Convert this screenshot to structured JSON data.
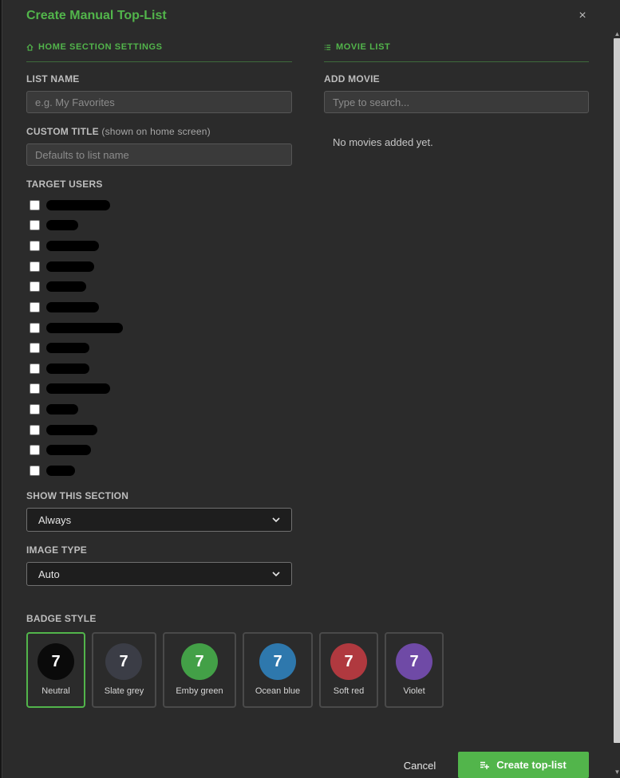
{
  "dialog": {
    "title": "Create Manual Top-List",
    "close_glyph": "×"
  },
  "home_section": {
    "heading": "HOME SECTION SETTINGS",
    "icon": "home-icon",
    "list_name_label": "LIST NAME",
    "list_name_placeholder": "e.g. My Favorites",
    "custom_title_label": "CUSTOM TITLE",
    "custom_title_sub": "(shown on home screen)",
    "custom_title_placeholder": "Defaults to list name",
    "target_users_label": "TARGET USERS",
    "users": [
      {
        "checked": false,
        "redacted": true
      },
      {
        "checked": false,
        "redacted": true
      },
      {
        "checked": false,
        "redacted": true
      },
      {
        "checked": false,
        "redacted": true
      },
      {
        "checked": false,
        "redacted": true
      },
      {
        "checked": false,
        "redacted": true
      },
      {
        "checked": false,
        "redacted": true
      },
      {
        "checked": false,
        "redacted": true
      },
      {
        "checked": false,
        "redacted": true
      },
      {
        "checked": false,
        "redacted": true
      },
      {
        "checked": false,
        "redacted": true
      },
      {
        "checked": false,
        "redacted": true
      },
      {
        "checked": false,
        "redacted": true
      },
      {
        "checked": false,
        "redacted": true
      }
    ],
    "show_section_label": "SHOW THIS SECTION",
    "show_section_value": "Always",
    "image_type_label": "IMAGE TYPE",
    "image_type_value": "Auto",
    "badge_style_label": "BADGE STYLE",
    "badge_number": "7",
    "badges": [
      {
        "name": "Neutral",
        "color": "#0a0a0a",
        "selected": true
      },
      {
        "name": "Slate grey",
        "color": "#3b3d46",
        "selected": false
      },
      {
        "name": "Emby green",
        "color": "#43a047",
        "selected": false
      },
      {
        "name": "Ocean blue",
        "color": "#2e78ad",
        "selected": false
      },
      {
        "name": "Soft red",
        "color": "#b0393f",
        "selected": false
      },
      {
        "name": "Violet",
        "color": "#6f4aa6",
        "selected": false
      }
    ]
  },
  "movie_list": {
    "heading": "MOVIE LIST",
    "icon": "list-icon",
    "add_movie_label": "ADD MOVIE",
    "search_placeholder": "Type to search...",
    "empty_text": "No movies added yet."
  },
  "footer": {
    "cancel_label": "Cancel",
    "create_label": "Create top-list",
    "create_icon": "playlist-add-icon"
  },
  "colors": {
    "accent": "#52b54b",
    "background": "#2b2b2b"
  }
}
